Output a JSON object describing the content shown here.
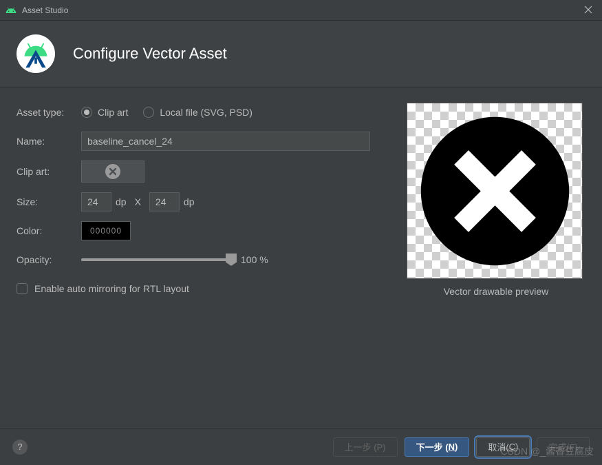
{
  "window": {
    "title": "Asset Studio"
  },
  "header": {
    "title": "Configure Vector Asset"
  },
  "form": {
    "asset_type_label": "Asset type:",
    "radio_clip_art": "Clip art",
    "radio_local_file": "Local file (SVG, PSD)",
    "name_label": "Name:",
    "name_value": "baseline_cancel_24",
    "clip_art_label": "Clip art:",
    "size_label": "Size:",
    "size_w": "24",
    "size_h": "24",
    "dp": "dp",
    "x": "X",
    "color_label": "Color:",
    "color_value": "000000",
    "opacity_label": "Opacity:",
    "opacity_value": "100 %",
    "mirror_label": "Enable auto mirroring for RTL layout"
  },
  "preview": {
    "label": "Vector drawable preview"
  },
  "footer": {
    "prev": "上一步 (P)",
    "next_prefix": "下一步 (",
    "next_key": "N",
    "next_suffix": ")",
    "cancel_prefix": "取消(",
    "cancel_key": "C",
    "cancel_suffix": ")",
    "finish": "完成(F)"
  },
  "watermark": "CSDN @_酱香豆腐皮"
}
